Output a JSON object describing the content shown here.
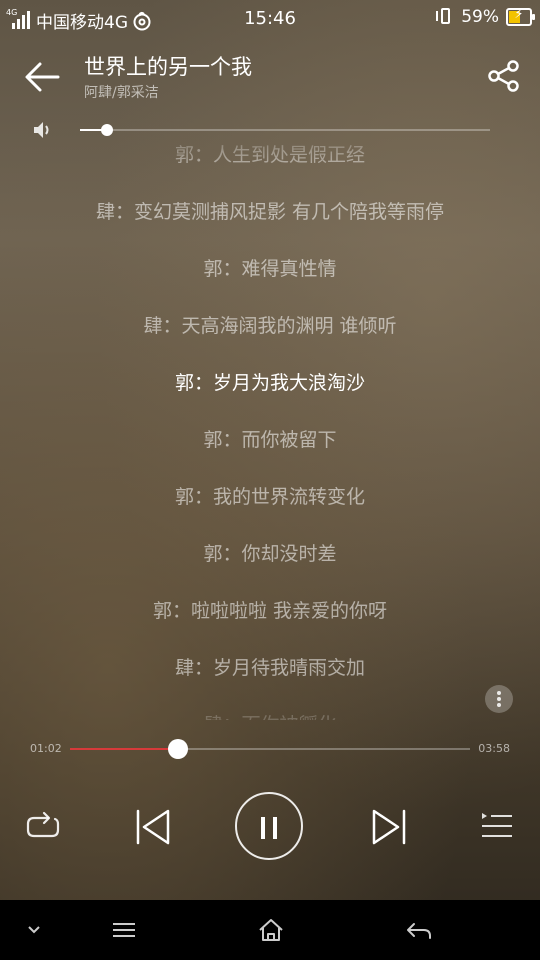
{
  "status_bar": {
    "network_tag": "4G",
    "carrier": "中国移动4G",
    "time": "15:46",
    "battery": "59%",
    "battery_level": 0.59,
    "icons": [
      "signal-icon",
      "netease-cloud-music-icon",
      "vibrate-icon",
      "battery-charging-icon"
    ]
  },
  "header": {
    "title": "世界上的另一个我",
    "artist": "阿肆/郭采洁",
    "icons": [
      "back-arrow-icon",
      "share-icon"
    ]
  },
  "volume": {
    "icon": "speaker-icon",
    "level": 0.065
  },
  "lyrics": {
    "lines": [
      {
        "text": "郭：人生到处是假正经",
        "active": false
      },
      {
        "text": "肆：变幻莫测捕风捉影 有几个陪我等雨停",
        "active": false
      },
      {
        "text": "郭：难得真性情",
        "active": false
      },
      {
        "text": "肆：天高海阔我的渊明 谁倾听",
        "active": false
      },
      {
        "text": "郭：岁月为我大浪淘沙",
        "active": true
      },
      {
        "text": "郭：而你被留下",
        "active": false
      },
      {
        "text": "郭：我的世界流转变化",
        "active": false
      },
      {
        "text": "郭：你却没时差",
        "active": false
      },
      {
        "text": "郭：啦啦啦啦 我亲爱的你呀",
        "active": false
      },
      {
        "text": "肆：岁月待我晴雨交加",
        "active": false
      },
      {
        "text": "肆：而你被孵化",
        "active": false
      }
    ]
  },
  "progress": {
    "current": "01:02",
    "total": "03:58",
    "fraction": 0.27,
    "accent_color": "#d63a3a"
  },
  "controls": {
    "icons": [
      "repeat-icon",
      "previous-track-icon",
      "pause-icon",
      "next-track-icon",
      "playlist-icon"
    ]
  },
  "navbar": {
    "icons": [
      "chevron-down-icon",
      "menu-icon",
      "home-icon",
      "back-icon"
    ]
  }
}
